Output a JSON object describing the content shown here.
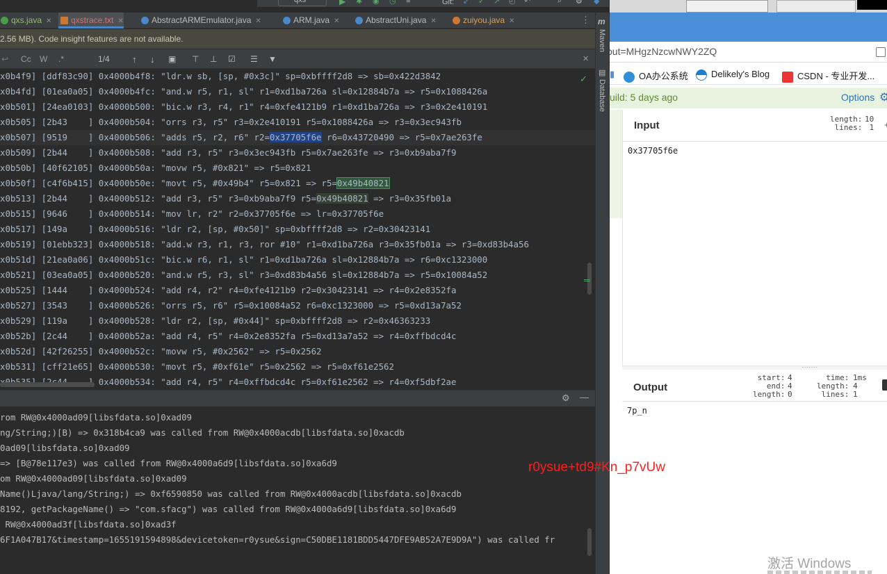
{
  "toolbar": {
    "run_config": "qxs",
    "git_label": "Git:"
  },
  "tabs": [
    {
      "label": "qxs.java",
      "color": "#4a9c4a"
    },
    {
      "label": "qxstrace.txt",
      "color": "#cc7832"
    },
    {
      "label": "AbstractARMEmulator.java",
      "color": "#4a88c7"
    },
    {
      "label": "ARM.java",
      "color": "#4a88c7"
    },
    {
      "label": "AbstractUni.java",
      "color": "#4a88c7"
    },
    {
      "label": "zuiyou.java",
      "color": "#cc7832"
    }
  ],
  "notice": "2.56 MB). Code insight features are not available.",
  "findbar": {
    "cc": "Cc",
    "w": "W",
    "star": ".*",
    "count": "1/4"
  },
  "code_lines": [
    "x0b4f9] [ddf83c90] 0x4000b4f8: \"ldr.w sb, [sp, #0x3c]\" sp=0xbffff2d8 => sb=0x422d3842",
    "x0b4fd] [01ea0a05] 0x4000b4fc: \"and.w r5, r1, sl\" r1=0xd1ba726a sl=0x12884b7a => r5=0x1088426a",
    "x0b501] [24ea0103] 0x4000b500: \"bic.w r3, r4, r1\" r4=0xfe4121b9 r1=0xd1ba726a => r3=0x2e410191",
    "x0b505] [2b43    ] 0x4000b504: \"orrs r3, r5\" r3=0x2e410191 r5=0x1088426a => r3=0x3ec943fb",
    "x0b507] [9519    ] 0x4000b506: \"adds r5, r2, r6\" r2=",
    "x0b509] [2b44    ] 0x4000b508: \"add r3, r5\" r3=0x3ec943fb r5=0x7ae263fe => r3=0xb9aba7f9",
    "x0b50b] [40f62105] 0x4000b50a: \"movw r5, #0x821\" => r5=0x821",
    "x0b50f] [c4f6b415] 0x4000b50e: \"movt r5, #0x49b4\" r5=0x821 => r5=",
    "x0b513] [2b44    ] 0x4000b512: \"add r3, r5\" r3=0xb9aba7f9 r5=",
    "x0b515] [9646    ] 0x4000b514: \"mov lr, r2\" r2=0x37705f6e => lr=0x37705f6e",
    "x0b517] [149a    ] 0x4000b516: \"ldr r2, [sp, #0x50]\" sp=0xbffff2d8 => r2=0x30423141",
    "x0b519] [01ebb323] 0x4000b518: \"add.w r3, r1, r3, ror #10\" r1=0xd1ba726a r3=0x35fb01a => r3=0xd83b4a56",
    "x0b51d] [21ea0a06] 0x4000b51c: \"bic.w r6, r1, sl\" r1=0xd1ba726a sl=0x12884b7a => r6=0xc1323000",
    "x0b521] [03ea0a05] 0x4000b520: \"and.w r5, r3, sl\" r3=0xd83b4a56 sl=0x12884b7a => r5=0x10084a52",
    "x0b525] [1444    ] 0x4000b524: \"add r4, r2\" r4=0xfe4121b9 r2=0x30423141 => r4=0x2e8352fa",
    "x0b527] [3543    ] 0x4000b526: \"orrs r5, r6\" r5=0x10084a52 r6=0xc1323000 => r5=0xd13a7a52",
    "x0b529] [119a    ] 0x4000b528: \"ldr r2, [sp, #0x44]\" sp=0xbffff2d8 => r2=0x46363233",
    "x0b52b] [2c44    ] 0x4000b52a: \"add r4, r5\" r4=0x2e8352fa r5=0xd13a7a52 => r4=0xffbdcd4c",
    "x0b52d] [42f26255] 0x4000b52c: \"movw r5, #0x2562\" => r5=0x2562",
    "x0b531] [cff21e65] 0x4000b530: \"movt r5, #0xf61e\" r5=0x2562 => r5=0xf61e2562",
    "x0b535] [2c44    ] 0x4000b534: \"add r4, r5\" r4=0xffbdcd4c r5=0xf61e2562 => r4=0xf5dbf2ae"
  ],
  "code_hl": {
    "l4_hl": "0x37705f6e",
    "l4_rest": " r6=0x43720490 => r5=0x7ae263fe",
    "l7_hl": "0x49b40821",
    "l8_hl": "0x49b40821",
    "l8_rest": " => r3=0x35fb01a"
  },
  "console_lines": [
    "rom RW@0x4000ad09[libsfdata.so]0xad09",
    "ng/String;)[B) => 0x318b4ca9 was called from RW@0x4000acdb[libsfdata.so]0xacdb",
    "0ad09[libsfdata.so]0xad09",
    "=> [B@78e117e3) was called from RW@0x4000a6d9[libsfdata.so]0xa6d9",
    "om RW@0x4000ad09[libsfdata.so]0xad09",
    "Name()Ljava/lang/String;) => 0xf6590850 was called from RW@0x4000acdb[libsfdata.so]0xacdb",
    "8192, getPackageName() => \"com.sfacg\") was called from RW@0x4000a6d9[libsfdata.so]0xa6d9",
    " RW@0x4000ad3f[libsfdata.so]0xad3f",
    "6F1A047B17&timestamp=1655191594898&devicetoken=r0ysue&sign=C50DBE1181BDD5447DFE9AB52A7E9D9A\") was called fr"
  ],
  "side_tools": [
    "Maven",
    "Database"
  ],
  "browser": {
    "address": "put=MHgzNzcwNWY2ZQ",
    "bookmarks": [
      "OA办公系统",
      "Delikely's Blog",
      "CSDN - 专业开发..."
    ],
    "build_text": "uild: 5 days ago",
    "options": "Options"
  },
  "input_panel": {
    "title": "Input",
    "meta_labels": "length:\n lines:",
    "meta_values": "10\n 1",
    "value": "0x37705f6e"
  },
  "output_panel": {
    "title": "Output",
    "meta_col1_labels": " start:\n   end:\nlength:",
    "meta_col1_values": "4\n4\n0",
    "meta_col2_labels": "  time:\nlength:\n lines:",
    "meta_col2_values": "1ms\n4\n1",
    "value": "7p_n"
  },
  "overlay_text": "r0ysue+td9#Kn_p7vUw",
  "watermark": "激活 Windows"
}
